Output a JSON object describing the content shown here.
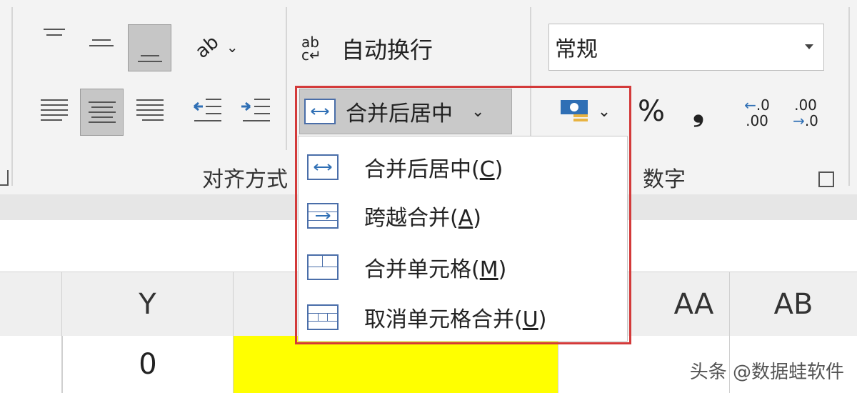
{
  "ribbon": {
    "wrap_text_label": "自动换行",
    "merge_center_label": "合并后居中",
    "alignment_group_label": "对齐方式",
    "number_group_label": "数字",
    "number_format": {
      "selected": "常规"
    },
    "percent_symbol": "%",
    "comma_symbol": "❟",
    "increase_decimal": [
      ".0",
      ".00"
    ],
    "decrease_decimal": [
      ".00",
      ".0"
    ]
  },
  "merge_menu": {
    "items": [
      {
        "text": "合并后居中(",
        "key": "C",
        "end": ")"
      },
      {
        "text": "跨越合并(",
        "key": "A",
        "end": ")"
      },
      {
        "text": "合并单元格(",
        "key": "M",
        "end": ")"
      },
      {
        "text": "取消单元格合并(",
        "key": "U",
        "end": ")"
      }
    ]
  },
  "grid": {
    "col_headers": [
      "Y",
      "AA",
      "AB"
    ],
    "row1": {
      "y_value": "0"
    },
    "highlight_color": "#ffff00"
  },
  "watermark": "头条 @数据蛙软件"
}
